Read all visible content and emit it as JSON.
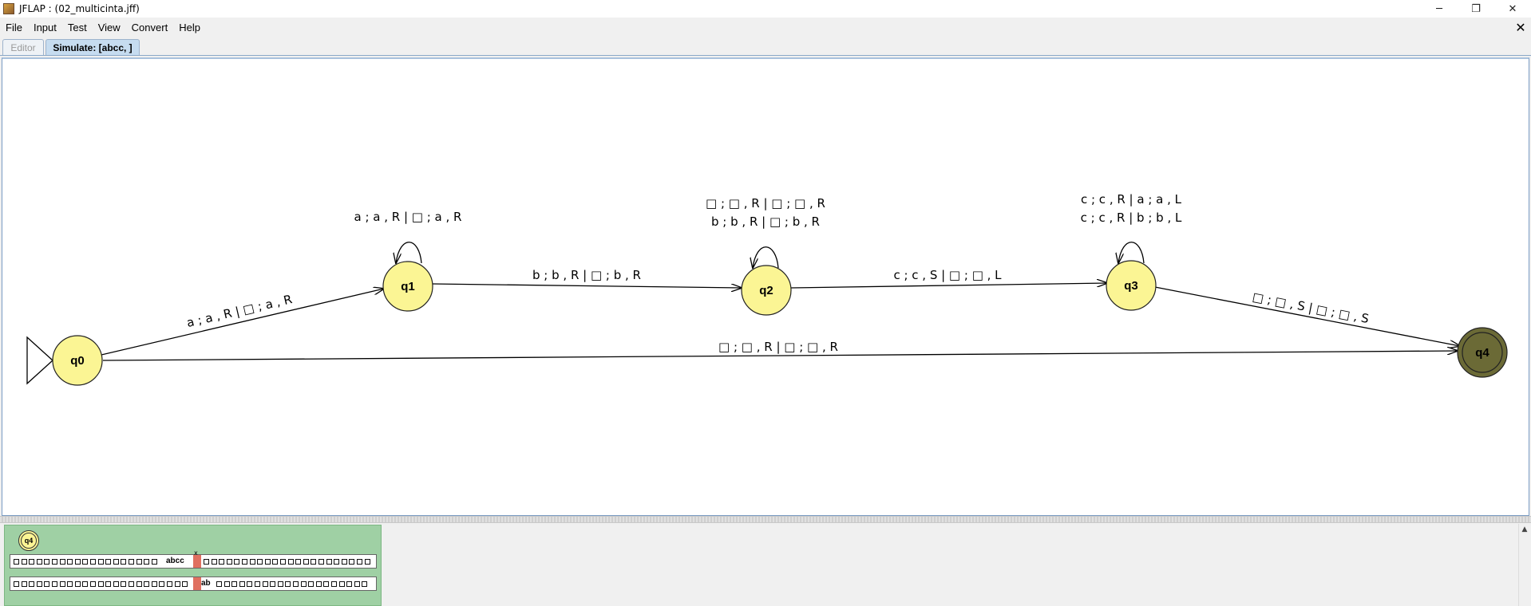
{
  "window": {
    "title": "JFLAP : (02_multicinta.jff)",
    "controls": {
      "minimize": "─",
      "maximize": "❐",
      "close": "✕"
    }
  },
  "menu": {
    "items": [
      "File",
      "Input",
      "Test",
      "View",
      "Convert",
      "Help"
    ],
    "close_glyph": "✕"
  },
  "tabs": {
    "editor": "Editor",
    "simulate": "Simulate: [abcc, ]"
  },
  "automaton": {
    "states": [
      "q0",
      "q1",
      "q2",
      "q3",
      "q4"
    ],
    "initial_state": "q0",
    "final_state": "q4",
    "transitions": {
      "q0_q1": "a ; a , R | □ ; a , R",
      "q0_q4": "□ ; □ , R | □ ; □ , R",
      "q1_loop": "a ; a , R | □ ; a , R",
      "q1_q2": "b ; b , R | □ ; b , R",
      "q2_loop_1": "□ ; □ , R | □ ; □ , R",
      "q2_loop_2": "b ; b , R | □ ; b , R",
      "q2_q3": "c ; c , S | □ ; □ , L",
      "q3_loop_1": "c ; c , R | a ; a , L",
      "q3_loop_2": "c ; c , R | b ; b , L",
      "q3_q4": "□ ; □ , S | □ ; □ , S"
    }
  },
  "configuration": {
    "state": "q4",
    "tape1": "abcc",
    "tape2": "ab",
    "head_marker": "x"
  },
  "scrollbar": {
    "up_glyph": "▲"
  },
  "colors": {
    "state_fill": "#fbf594",
    "final_state_fill": "#6b6a36",
    "config_bg": "#9fd0a4",
    "head": "#e07060",
    "tab_active": "#c6dcf0"
  }
}
